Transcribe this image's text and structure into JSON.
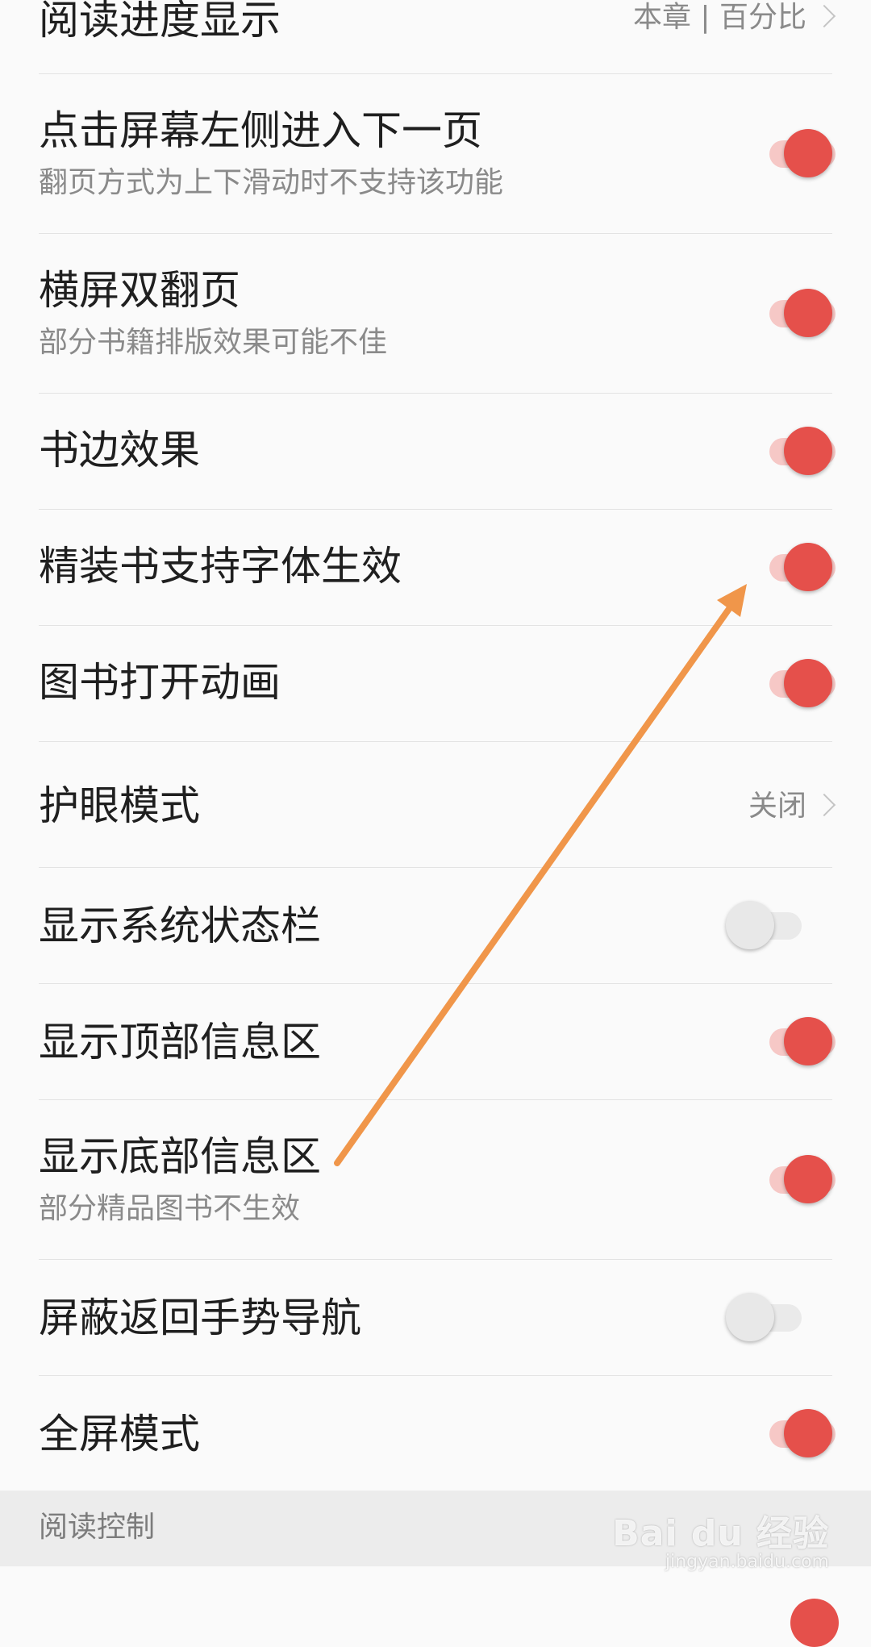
{
  "rows": [
    {
      "title": "阅读进度显示",
      "value": "本章 | 百分比"
    },
    {
      "title": "点击屏幕左侧进入下一页",
      "subtitle": "翻页方式为上下滑动时不支持该功能",
      "toggle": "on"
    },
    {
      "title": "横屏双翻页",
      "subtitle": "部分书籍排版效果可能不佳",
      "toggle": "on"
    },
    {
      "title": "书边效果",
      "toggle": "on"
    },
    {
      "title": "精装书支持字体生效",
      "toggle": "on"
    },
    {
      "title": "图书打开动画",
      "toggle": "on"
    },
    {
      "title": "护眼模式",
      "value": "关闭"
    },
    {
      "title": "显示系统状态栏",
      "toggle": "off"
    },
    {
      "title": "显示顶部信息区",
      "toggle": "on"
    },
    {
      "title": "显示底部信息区",
      "subtitle": "部分精品图书不生效",
      "toggle": "on"
    },
    {
      "title": "屏蔽返回手势导航",
      "toggle": "off"
    },
    {
      "title": "全屏模式",
      "toggle": "on"
    }
  ],
  "section_header": "阅读控制",
  "watermark": {
    "logo": "Bai du 经验",
    "url": "jingyan.baidu.com"
  },
  "colors": {
    "toggle_on_knob": "#e5504b",
    "toggle_on_track": "#f6c8c6",
    "toggle_off_knob": "#e8e8e8",
    "annotation_arrow": "#f0964a"
  }
}
